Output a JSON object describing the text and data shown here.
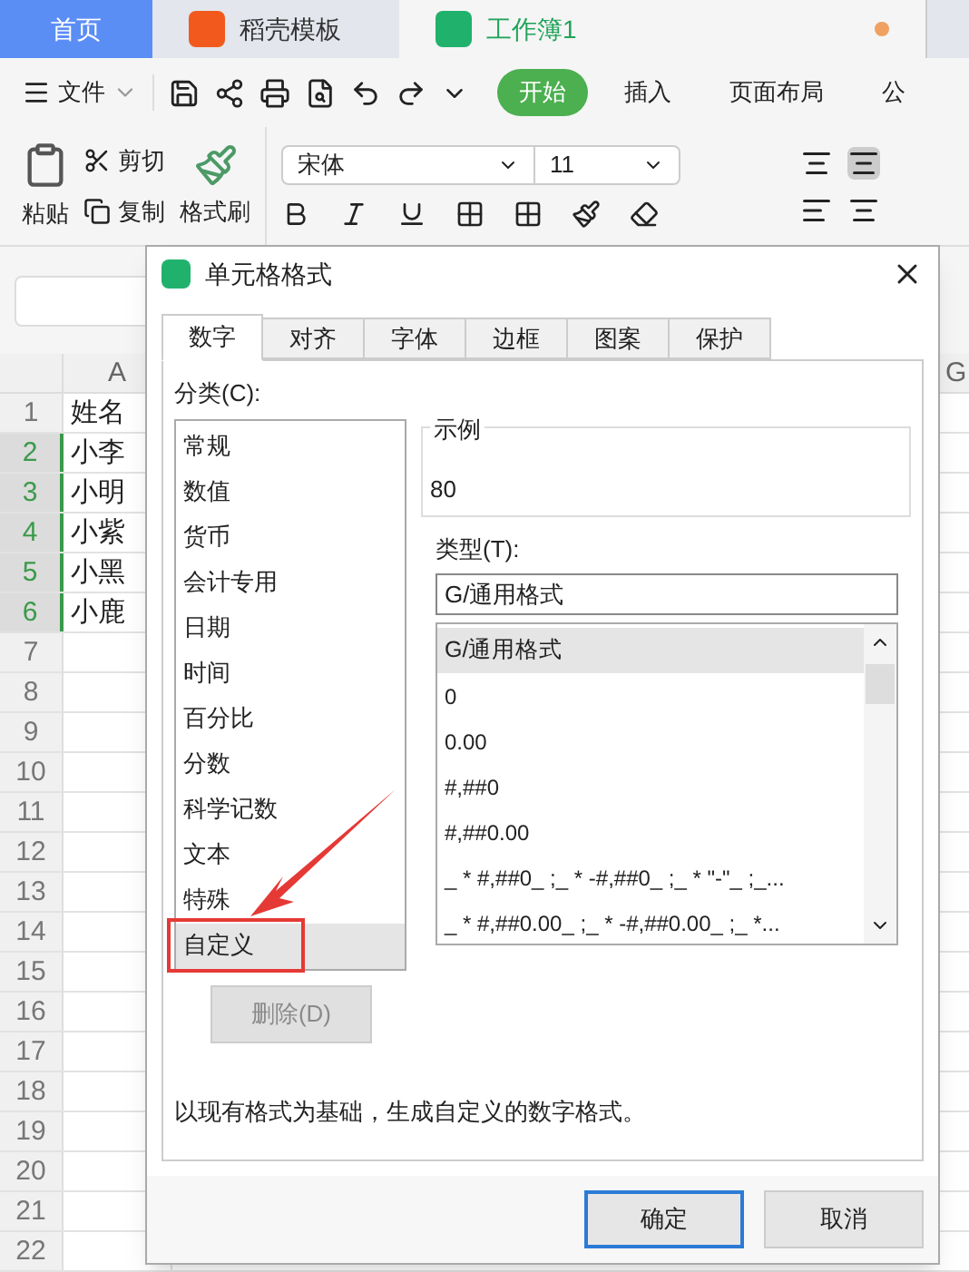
{
  "app_tabs": [
    {
      "label": "首页",
      "kind": "home",
      "selected": false
    },
    {
      "label": "稻壳模板",
      "kind": "template",
      "selected": false
    },
    {
      "label": "工作簿1",
      "kind": "workbook",
      "selected": true,
      "unsaved": true
    }
  ],
  "menu": {
    "file": "文件",
    "ribbon_tabs": [
      {
        "label": "开始",
        "selected": true
      },
      {
        "label": "插入",
        "selected": false
      },
      {
        "label": "页面布局",
        "selected": false
      },
      {
        "label": "公",
        "selected": false
      }
    ]
  },
  "ribbon": {
    "paste": "粘贴",
    "cut": "剪切",
    "copy": "复制",
    "format_painter": "格式刷",
    "font": "宋体",
    "font_size": "11"
  },
  "sheet": {
    "columns": [
      "A",
      "G"
    ],
    "rows": [
      {
        "number": "1",
        "name": "姓名",
        "selected": false
      },
      {
        "number": "2",
        "name": "小李",
        "selected": true
      },
      {
        "number": "3",
        "name": "小明",
        "selected": true
      },
      {
        "number": "4",
        "name": "小紫",
        "selected": true
      },
      {
        "number": "5",
        "name": "小黑",
        "selected": true
      },
      {
        "number": "6",
        "name": "小鹿",
        "selected": true
      },
      {
        "number": "7"
      },
      {
        "number": "8"
      },
      {
        "number": "9"
      },
      {
        "number": "10"
      },
      {
        "number": "11"
      },
      {
        "number": "12"
      },
      {
        "number": "13"
      },
      {
        "number": "14"
      },
      {
        "number": "15"
      },
      {
        "number": "16"
      },
      {
        "number": "17"
      },
      {
        "number": "18"
      },
      {
        "number": "19"
      },
      {
        "number": "20"
      },
      {
        "number": "21"
      },
      {
        "number": "22"
      }
    ]
  },
  "dialog": {
    "title": "单元格格式",
    "tabs": [
      {
        "label": "数字",
        "selected": true
      },
      {
        "label": "对齐",
        "selected": false
      },
      {
        "label": "字体",
        "selected": false
      },
      {
        "label": "边框",
        "selected": false
      },
      {
        "label": "图案",
        "selected": false
      },
      {
        "label": "保护",
        "selected": false
      }
    ],
    "category_label": "分类(C):",
    "categories": [
      {
        "label": "常规",
        "selected": false
      },
      {
        "label": "数值",
        "selected": false
      },
      {
        "label": "货币",
        "selected": false
      },
      {
        "label": "会计专用",
        "selected": false
      },
      {
        "label": "日期",
        "selected": false
      },
      {
        "label": "时间",
        "selected": false
      },
      {
        "label": "百分比",
        "selected": false
      },
      {
        "label": "分数",
        "selected": false
      },
      {
        "label": "科学记数",
        "selected": false
      },
      {
        "label": "文本",
        "selected": false
      },
      {
        "label": "特殊",
        "selected": false
      },
      {
        "label": "自定义",
        "selected": true
      }
    ],
    "sample_label": "示例",
    "sample_value": "80",
    "type_label": "类型(T):",
    "type_value": "G/通用格式",
    "types": [
      {
        "label": "G/通用格式",
        "selected": true
      },
      {
        "label": "0",
        "selected": false
      },
      {
        "label": "0.00",
        "selected": false
      },
      {
        "label": "#,##0",
        "selected": false
      },
      {
        "label": "#,##0.00",
        "selected": false
      },
      {
        "label": "_ * #,##0_ ;_ * -#,##0_ ;_ * \"-\"_ ;_...",
        "selected": false
      },
      {
        "label": "_ * #,##0.00_ ;_ * -#,##0.00_ ;_ *...",
        "selected": false
      }
    ],
    "delete_button": {
      "label": "删除(D)",
      "disabled": true
    },
    "description": "以现有格式为基础，生成自定义的数字格式。",
    "ok": "确定",
    "cancel": "取消"
  }
}
